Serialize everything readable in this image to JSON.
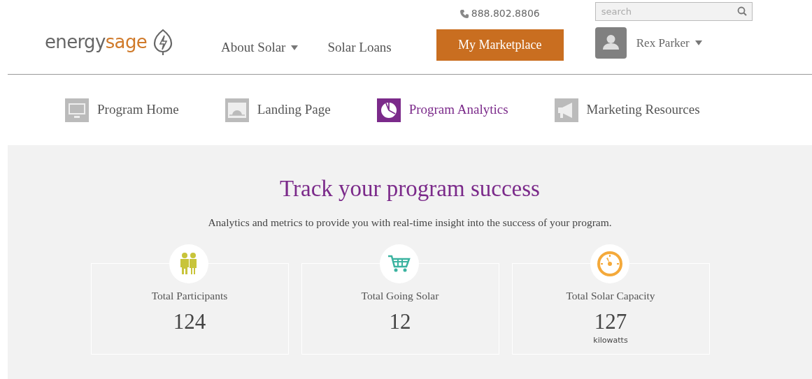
{
  "logo": {
    "text_1": "energy",
    "text_2": "sage"
  },
  "nav": [
    {
      "label": "About Solar",
      "dropdown": true
    },
    {
      "label": "Solar Loans",
      "dropdown": false
    }
  ],
  "phone": "888.802.8806",
  "marketplace_button": "My Marketplace",
  "search": {
    "placeholder": "search"
  },
  "user": {
    "name": "Rex Parker"
  },
  "subnav": [
    {
      "label": "Program Home",
      "kind": "monitor",
      "selected": false
    },
    {
      "label": "Landing Page",
      "kind": "landing",
      "selected": false
    },
    {
      "label": "Program Analytics",
      "kind": "pie",
      "selected": true
    },
    {
      "label": "Marketing Resources",
      "kind": "megaphone",
      "selected": false
    }
  ],
  "hero": {
    "title": "Track your program success",
    "subtitle": "Analytics and metrics to provide you with real-time insight into the success of your program."
  },
  "stats": [
    {
      "kind": "people",
      "label": "Total Participants",
      "value": "124"
    },
    {
      "kind": "cart",
      "label": "Total Going Solar",
      "value": "12"
    },
    {
      "kind": "gauge",
      "label": "Total Solar Capacity",
      "value": "127",
      "unit": "kilowatts"
    }
  ]
}
